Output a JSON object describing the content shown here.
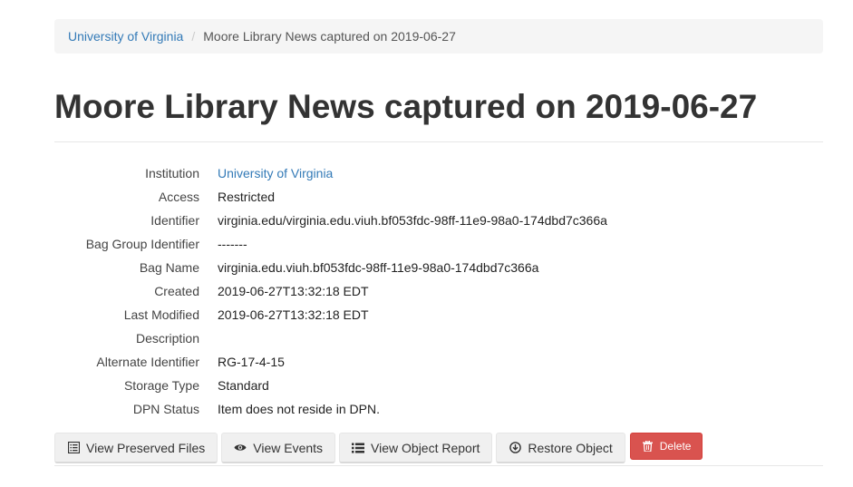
{
  "breadcrumb": {
    "home": "University of Virginia",
    "separator": "/",
    "current": "Moore Library News captured on 2019-06-27"
  },
  "page_title": "Moore Library News captured on 2019-06-27",
  "details": [
    {
      "label": "Institution",
      "value": "University of Virginia",
      "link": true
    },
    {
      "label": "Access",
      "value": "Restricted"
    },
    {
      "label": "Identifier",
      "value": "virginia.edu/virginia.edu.viuh.bf053fdc-98ff-11e9-98a0-174dbd7c366a"
    },
    {
      "label": "Bag Group Identifier",
      "value": "-------"
    },
    {
      "label": "Bag Name",
      "value": "virginia.edu.viuh.bf053fdc-98ff-11e9-98a0-174dbd7c366a"
    },
    {
      "label": "Created",
      "value": "2019-06-27T13:32:18 EDT"
    },
    {
      "label": "Last Modified",
      "value": "2019-06-27T13:32:18 EDT"
    },
    {
      "label": "Description",
      "value": ""
    },
    {
      "label": "Alternate Identifier",
      "value": "RG-17-4-15"
    },
    {
      "label": "Storage Type",
      "value": "Standard"
    },
    {
      "label": "DPN Status",
      "value": "Item does not reside in DPN."
    }
  ],
  "actions": {
    "view_files": {
      "label": "View Preserved Files",
      "icon": "list-alt-icon"
    },
    "view_events": {
      "label": "View Events",
      "icon": "eye-icon"
    },
    "view_report": {
      "label": "View Object Report",
      "icon": "list-icon"
    },
    "restore": {
      "label": "Restore Object",
      "icon": "download-circle-icon"
    },
    "delete": {
      "label": "Delete",
      "icon": "trash-icon"
    }
  },
  "colors": {
    "link": "#337ab7",
    "danger": "#d9534f",
    "breadcrumb_bg": "#f5f5f5"
  }
}
